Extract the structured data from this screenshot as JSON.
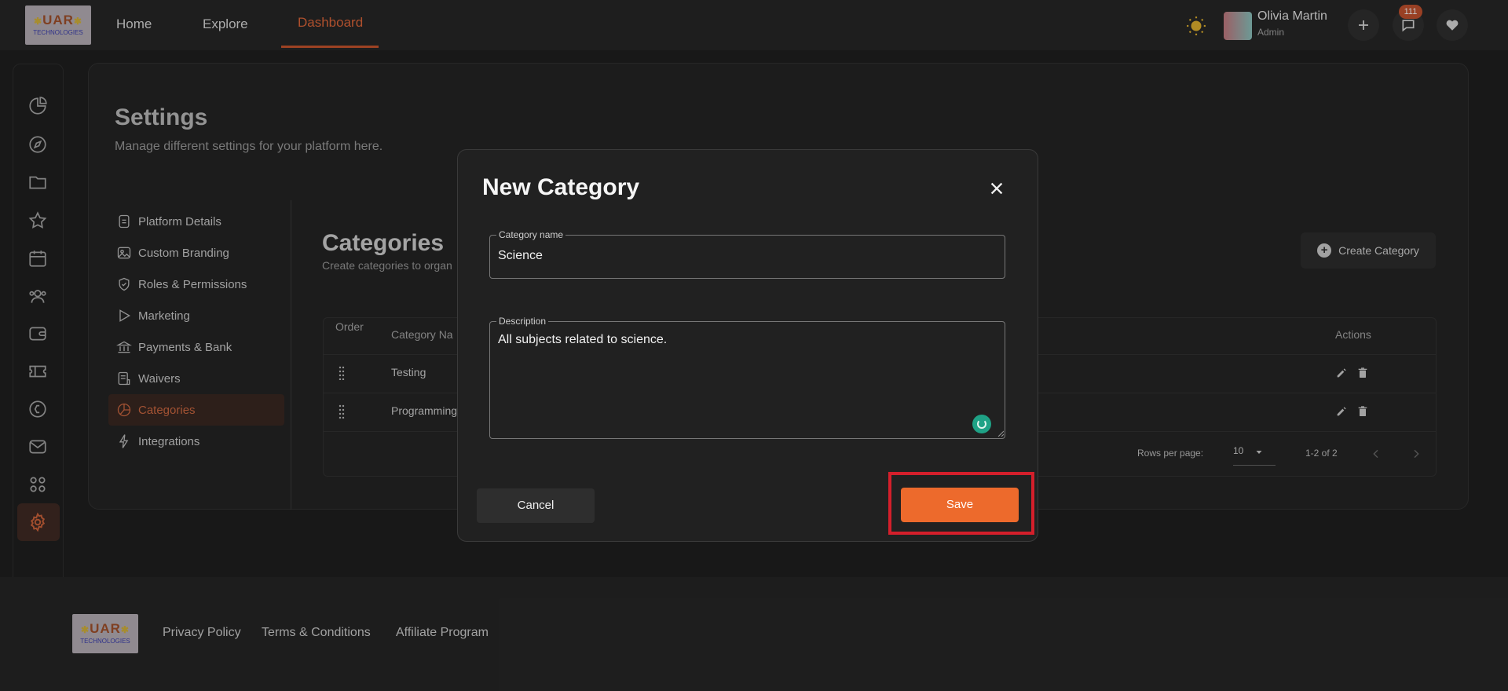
{
  "header": {
    "logo_text": "UAR",
    "logo_sub": "TECHNOLOGIES",
    "nav": [
      {
        "label": "Home"
      },
      {
        "label": "Explore"
      },
      {
        "label": "Dashboard",
        "active": true
      }
    ],
    "user": {
      "name": "Olivia Martin",
      "role": "Admin"
    },
    "notification_count": "111"
  },
  "sidebar": {
    "icons": [
      "chart-pie-icon",
      "compass-icon",
      "folder-icon",
      "star-icon",
      "calendar-icon",
      "users-icon",
      "wallet-icon",
      "ticket-icon",
      "dollar-circle-icon",
      "mail-icon",
      "apps-icon",
      "gear-icon"
    ],
    "active": "gear-icon"
  },
  "settings": {
    "title": "Settings",
    "subtitle": "Manage different settings for your platform here.",
    "menu": [
      {
        "label": "Platform Details",
        "icon": "document-icon"
      },
      {
        "label": "Custom Branding",
        "icon": "image-icon"
      },
      {
        "label": "Roles & Permissions",
        "icon": "shield-check-icon"
      },
      {
        "label": "Marketing",
        "icon": "play-icon"
      },
      {
        "label": "Payments & Bank",
        "icon": "bank-icon"
      },
      {
        "label": "Waivers",
        "icon": "waiver-icon"
      },
      {
        "label": "Categories",
        "icon": "pie-chart-icon",
        "active": true
      },
      {
        "label": "Integrations",
        "icon": "bolt-icon"
      }
    ]
  },
  "categories": {
    "title": "Categories",
    "subtitle": "Create categories to organ",
    "create_label": "Create Category",
    "columns": {
      "order": "Order",
      "name": "Category Na",
      "actions": "Actions"
    },
    "rows": [
      {
        "name": "Testing"
      },
      {
        "name": "Programming"
      }
    ],
    "pagination": {
      "rows_per_page_label": "Rows per page:",
      "rows_per_page": "10",
      "range": "1-2 of 2"
    }
  },
  "modal": {
    "title": "New Category",
    "name_label": "Category name",
    "name_value": "Science",
    "description_label": "Description",
    "description_value": "All subjects related to science.",
    "cancel_label": "Cancel",
    "save_label": "Save"
  },
  "footer": {
    "logo_text": "UAR",
    "logo_sub": "TECHNOLOGIES",
    "links": [
      "Privacy Policy",
      "Terms & Conditions",
      "Affiliate Program"
    ]
  },
  "colors": {
    "accent": "#ed6a2c",
    "highlight": "#d41f2b",
    "background": "#1f1f1f"
  }
}
